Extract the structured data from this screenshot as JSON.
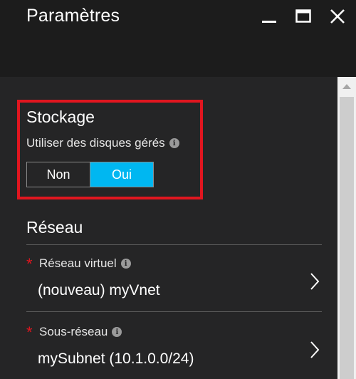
{
  "window": {
    "title": "Paramètres",
    "controls": [
      "minimize-icon",
      "maximize-icon",
      "close-icon"
    ]
  },
  "storage": {
    "heading": "Stockage",
    "managed_disks_label": "Utiliser des disques gérés",
    "toggle": {
      "options": [
        "Non",
        "Oui"
      ],
      "selected": "Oui"
    }
  },
  "network": {
    "heading": "Réseau",
    "fields": [
      {
        "required_mark": "*",
        "label": "Réseau virtuel",
        "value": "(nouveau) myVnet"
      },
      {
        "required_mark": "*",
        "label": "Sous-réseau",
        "value": "mySubnet (10.1.0.0/24)"
      }
    ]
  },
  "colors": {
    "accent": "#00b7f1",
    "highlight": "#e0161f",
    "background": "#252526"
  }
}
